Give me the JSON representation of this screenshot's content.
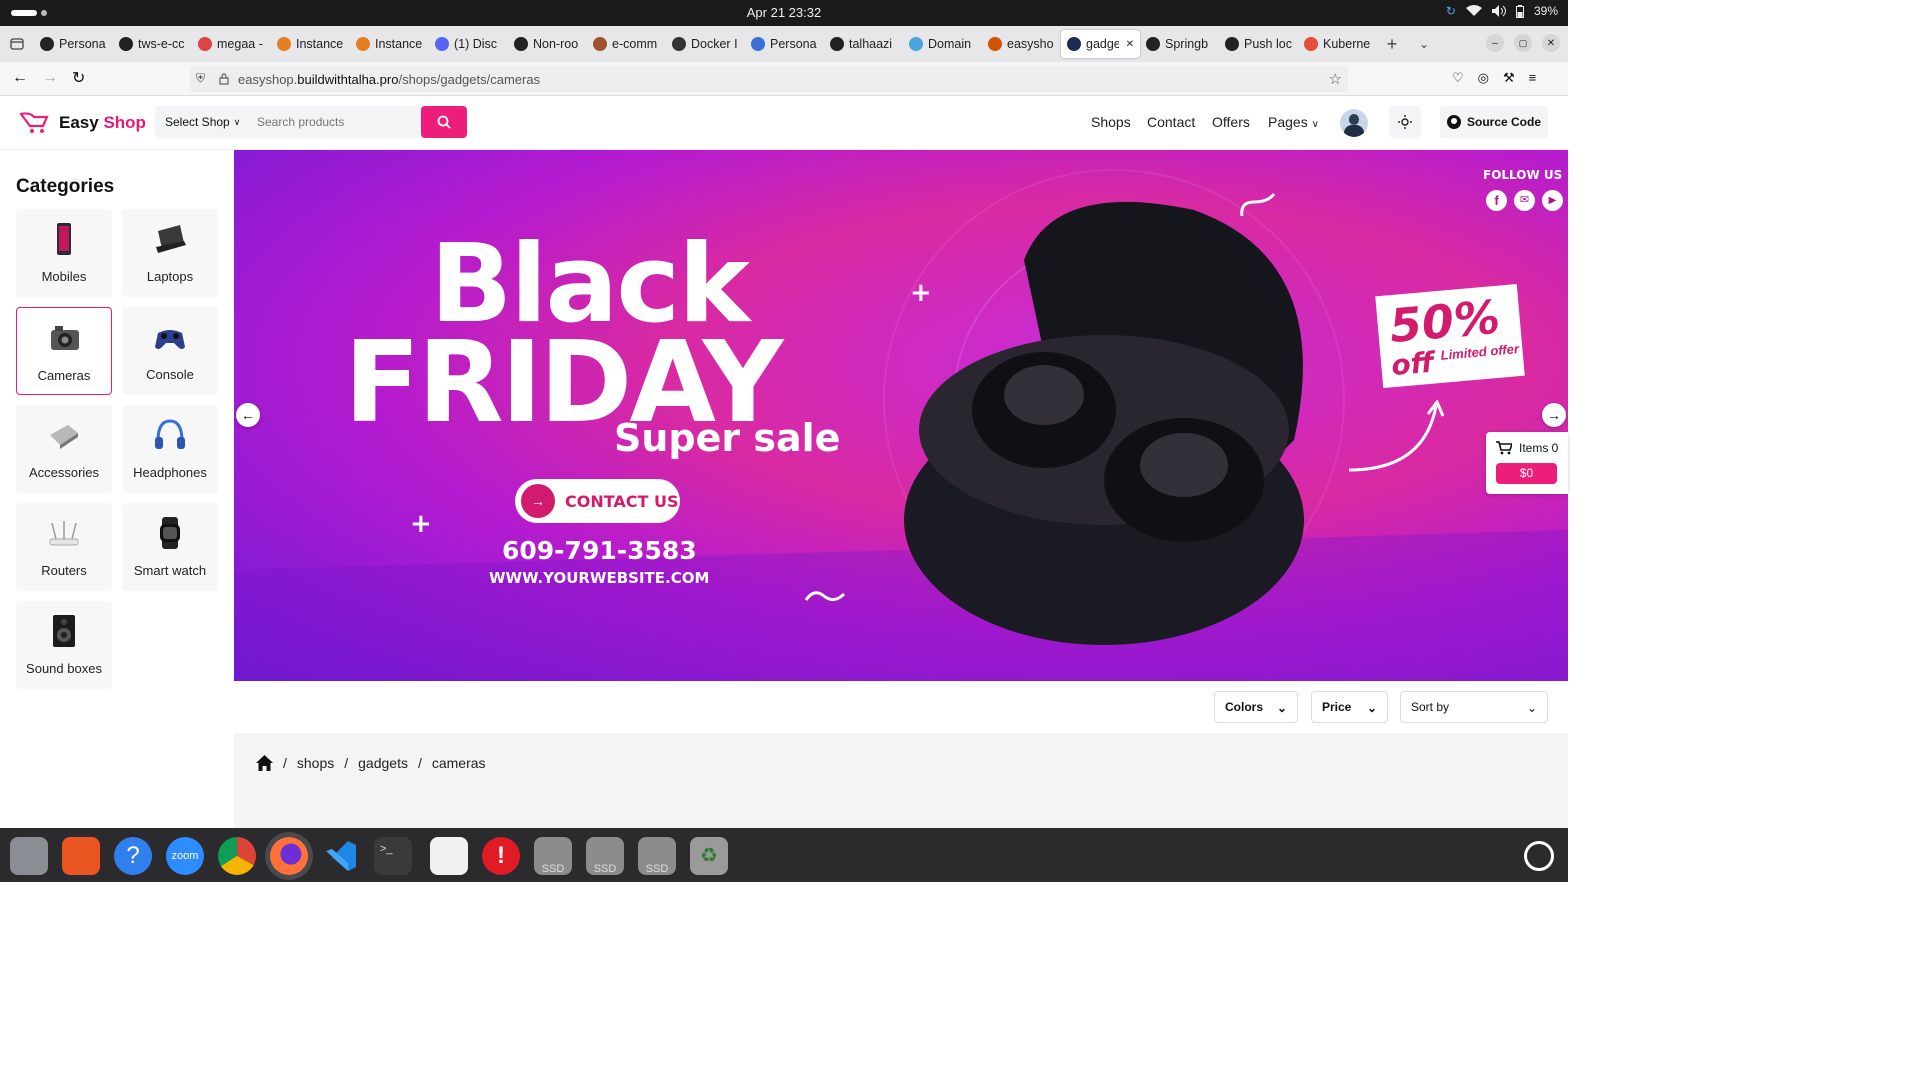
{
  "system": {
    "datetime": "Apr 21  23:32",
    "battery": "39%"
  },
  "browser": {
    "tabs": [
      {
        "label": "Persona",
        "color": "#222"
      },
      {
        "label": "tws-e-cc",
        "color": "#222"
      },
      {
        "label": "megaa -",
        "color": "#d44"
      },
      {
        "label": "Instance",
        "color": "#e67e22"
      },
      {
        "label": "Instance",
        "color": "#e67e22"
      },
      {
        "label": "(1) Disc",
        "color": "#5865f2"
      },
      {
        "label": "Non-roo",
        "color": "#222"
      },
      {
        "label": "e-comm",
        "color": "#a0522d"
      },
      {
        "label": "Docker I",
        "color": "#333"
      },
      {
        "label": "Persona",
        "color": "#3b6fd8"
      },
      {
        "label": "talhaazi",
        "color": "#222"
      },
      {
        "label": "Domain",
        "color": "#4aa3df"
      },
      {
        "label": "easysho",
        "color": "#d35400"
      },
      {
        "label": "gadge",
        "color": "#1e2a52"
      },
      {
        "label": "Springb",
        "color": "#222"
      },
      {
        "label": "Push loc",
        "color": "#222"
      },
      {
        "label": "Kuberne",
        "color": "#e74c3c"
      }
    ],
    "active_tab_index": 13,
    "url_prefix": "easyshop.",
    "url_host": "buildwithtalha.pro",
    "url_path": "/shops/gadgets/cameras"
  },
  "site": {
    "logo_easy": "Easy",
    "logo_shop": "Shop",
    "select_shop": "Select Shop",
    "search_placeholder": "Search products",
    "nav": [
      "Shops",
      "Contact",
      "Offers",
      "Pages"
    ],
    "source_code": "Source Code",
    "accent": "#ec1e7a"
  },
  "sidebar": {
    "title": "Categories",
    "categories": [
      "Mobiles",
      "Laptops",
      "Cameras",
      "Console",
      "Accessories",
      "Headphones",
      "Routers",
      "Smart watch",
      "Sound boxes"
    ],
    "selected": "Cameras"
  },
  "banner": {
    "line1": "Black",
    "line2": "FRIDAY",
    "line3": "Super sale",
    "contact": "CONTACT US",
    "phone": "609-791-3583",
    "website": "WWW.YOURWEBSITE.COM",
    "follow": "FOLLOW US",
    "discount": "50%",
    "off": "off",
    "limited": "Limited offer"
  },
  "cart": {
    "items_label": "Items 0",
    "total": "$0"
  },
  "filters": {
    "colors": "Colors",
    "price": "Price",
    "sort": "Sort by"
  },
  "breadcrumb": [
    "shops",
    "gadgets",
    "cameras"
  ],
  "dock_apps": [
    "files",
    "app-center",
    "help",
    "zoom",
    "chrome",
    "firefox",
    "vscode",
    "terminal",
    "text-editor",
    "updates",
    "ssd-1",
    "ssd-2",
    "ssd-3",
    "trash"
  ],
  "dock_labels": {
    "zoom": "zoom",
    "ssd": "SSD"
  }
}
